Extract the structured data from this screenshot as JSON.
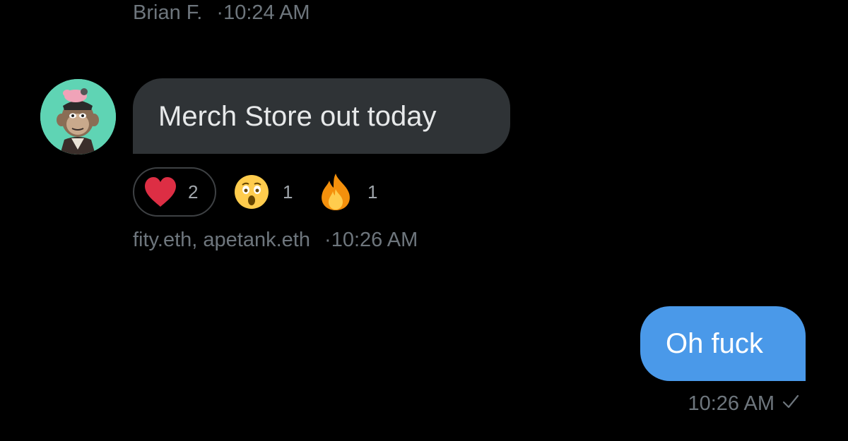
{
  "thread": {
    "top_meta": {
      "sender": "Brian F.",
      "separator": "·",
      "time": "10:24 AM"
    },
    "incoming": {
      "avatar": "ape-avatar",
      "text": "Merch Store out today",
      "reactions": [
        {
          "icon": "heart-emoji",
          "count": "2",
          "selected": true
        },
        {
          "icon": "astonished-face-emoji",
          "count": "1",
          "selected": false
        },
        {
          "icon": "fire-emoji",
          "count": "1",
          "selected": false
        }
      ],
      "meta": {
        "senders": "fity.eth, apetank.eth",
        "separator": "·",
        "time": "10:26 AM"
      }
    },
    "outgoing": {
      "text": "Oh fuck",
      "time": "10:26 AM",
      "status_icon": "checkmark-icon"
    }
  },
  "colors": {
    "background": "#000000",
    "incoming_bubble": "#2f3336",
    "outgoing_bubble": "#4a99e9",
    "meta_text": "#6e767d"
  }
}
